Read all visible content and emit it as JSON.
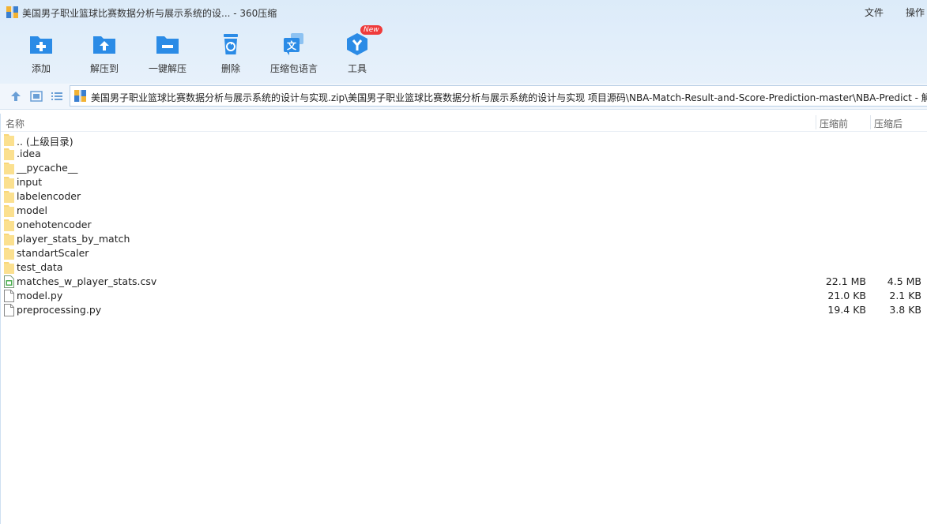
{
  "window": {
    "title": "美国男子职业篮球比赛数据分析与展示系统的设... - 360压缩",
    "menu": {
      "file": "文件",
      "operations": "操作"
    }
  },
  "toolbar": [
    {
      "label": "添加",
      "icon": "add-icon",
      "color": "#2b8be6"
    },
    {
      "label": "解压到",
      "icon": "extract-to-icon",
      "color": "#2b8be6"
    },
    {
      "label": "一键解压",
      "icon": "one-click-extract-icon",
      "color": "#2b8be6"
    },
    {
      "label": "删除",
      "icon": "recycle-bin-icon",
      "color": "#2b8be6"
    },
    {
      "label": "压缩包语言",
      "icon": "language-icon",
      "color": "#2b8be6"
    },
    {
      "label": "工具",
      "icon": "tools-icon",
      "color": "#2b8be6",
      "badge": "New"
    }
  ],
  "address": {
    "path": "美国男子职业篮球比赛数据分析与展示系统的设计与实现.zip\\美国男子职业篮球比赛数据分析与展示系统的设计与实现 项目源码\\NBA-Match-Result-and-Score-Prediction-master\\NBA-Predict - 解"
  },
  "columns": {
    "name": "名称",
    "size": "压缩前",
    "compressed": "压缩后"
  },
  "files": [
    {
      "name": ".. (上级目录)",
      "type": "folder",
      "size": "",
      "compressed": ""
    },
    {
      "name": ".idea",
      "type": "folder",
      "size": "",
      "compressed": ""
    },
    {
      "name": "__pycache__",
      "type": "folder",
      "size": "",
      "compressed": ""
    },
    {
      "name": "input",
      "type": "folder",
      "size": "",
      "compressed": ""
    },
    {
      "name": "labelencoder",
      "type": "folder",
      "size": "",
      "compressed": ""
    },
    {
      "name": "model",
      "type": "folder",
      "size": "",
      "compressed": ""
    },
    {
      "name": "onehotencoder",
      "type": "folder",
      "size": "",
      "compressed": ""
    },
    {
      "name": "player_stats_by_match",
      "type": "folder",
      "size": "",
      "compressed": ""
    },
    {
      "name": "standartScaler",
      "type": "folder",
      "size": "",
      "compressed": ""
    },
    {
      "name": "test_data",
      "type": "folder",
      "size": "",
      "compressed": ""
    },
    {
      "name": "matches_w_player_stats.csv",
      "type": "csv",
      "size": "22.1 MB",
      "compressed": "4.5 MB"
    },
    {
      "name": "model.py",
      "type": "file",
      "size": "21.0 KB",
      "compressed": "2.1 KB"
    },
    {
      "name": "preprocessing.py",
      "type": "file",
      "size": "19.4 KB",
      "compressed": "3.8 KB"
    }
  ]
}
